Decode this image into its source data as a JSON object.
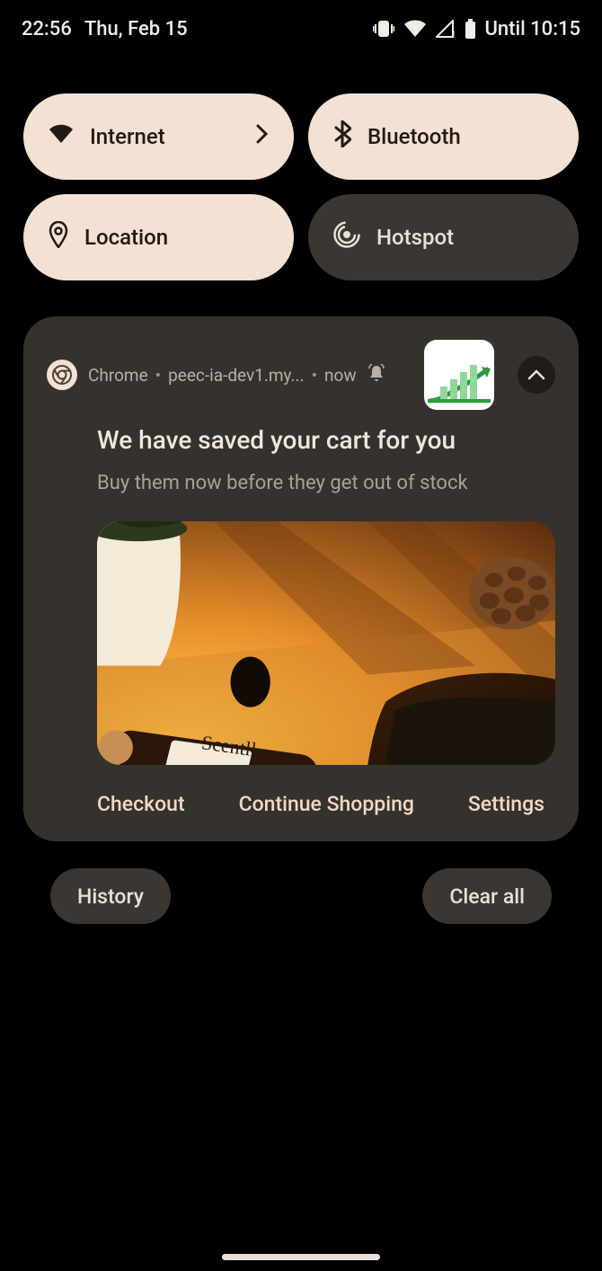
{
  "status": {
    "time": "22:56",
    "date": "Thu, Feb 15",
    "until": "Until 10:15"
  },
  "qs": {
    "internet": "Internet",
    "bluetooth": "Bluetooth",
    "location": "Location",
    "hotspot": "Hotspot"
  },
  "notification": {
    "app": "Chrome",
    "origin": "peec-ia-dev1.my...",
    "when": "now",
    "title": "We have saved your cart for you",
    "body": "Buy them now before they get out of stock",
    "image_label": "Scentll.",
    "actions": {
      "checkout": "Checkout",
      "continue": "Continue Shopping",
      "settings": "Settings"
    }
  },
  "footer": {
    "history": "History",
    "clear": "Clear all"
  }
}
